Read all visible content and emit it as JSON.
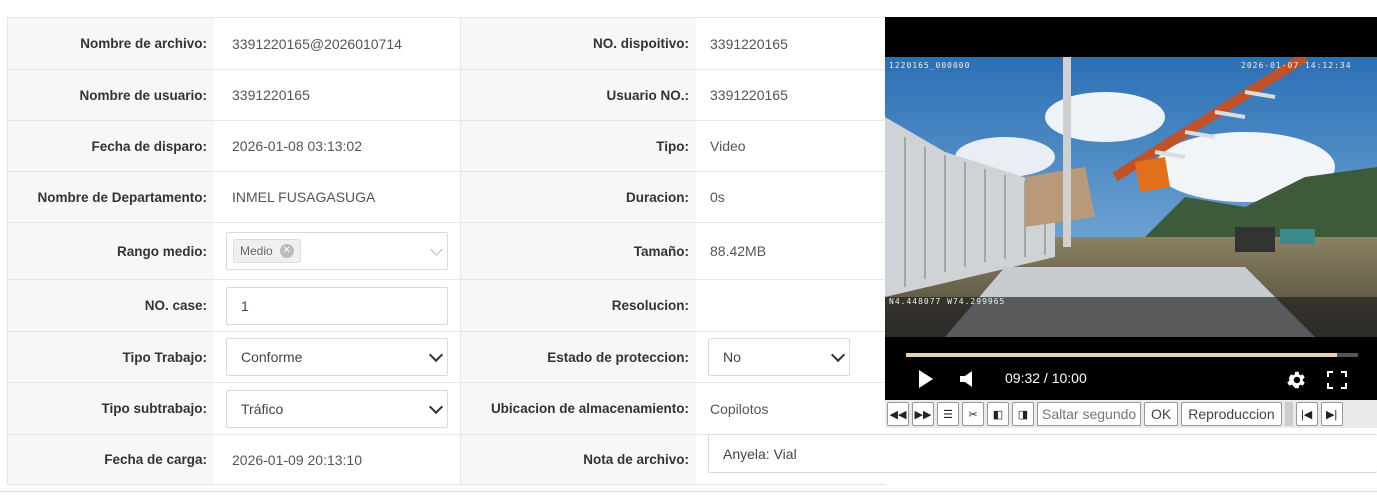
{
  "rows": [
    {
      "l1": "Nombre de archivo:",
      "v1": "3391220165@2026010714",
      "l2": "NO. dispoitivo:",
      "v2": "3391220165"
    },
    {
      "l1": "Nombre de usuario:",
      "v1": "3391220165",
      "l2": "Usuario NO.:",
      "v2": "3391220165"
    },
    {
      "l1": "Fecha de disparo:",
      "v1": "2026-01-08 03:13:02",
      "l2": "Tipo:",
      "v2": "Video"
    },
    {
      "l1": "Nombre de Departamento:",
      "v1": "INMEL FUSAGASUGA",
      "l2": "Duracion:",
      "v2": "0s"
    },
    {
      "l1": "Rango medio:",
      "v1_tag": "Medio",
      "l2": "Tamaño:",
      "v2": "88.42MB"
    },
    {
      "l1": "NO. case:",
      "v1_input": "1",
      "l2": "Resolucion:",
      "v2": ""
    },
    {
      "l1": "Tipo Trabajo:",
      "v1_select": "Conforme",
      "l2": "Estado de proteccion:",
      "v2_select": "No"
    },
    {
      "l1": "Tipo subtrabajo:",
      "v1_select": "Tráfico",
      "l2": "Ubicacion de almacenamiento:",
      "v2": "Copilotos"
    },
    {
      "l1": "Fecha de carga:",
      "v1": "2026-01-09 20:13:10",
      "l2": "Nota de archivo:",
      "v2_input": "Anyela: Vial"
    }
  ],
  "video": {
    "osd_top_left": "1220165_000000",
    "osd_top_right": "2026-01-07 14:12:34",
    "osd_bottom_left": "N4.448077 W74.299965",
    "time": "09:32 / 10:00",
    "progress": 0.953
  },
  "toolbar": {
    "icons": [
      "rewind-icon",
      "fast-forward-icon",
      "list-icon",
      "scissors-icon",
      "prev-frame-icon",
      "next-frame-icon"
    ],
    "seek_placeholder": "Saltar segundo",
    "ok_label": "OK",
    "playback_label": "Reproduccion"
  }
}
